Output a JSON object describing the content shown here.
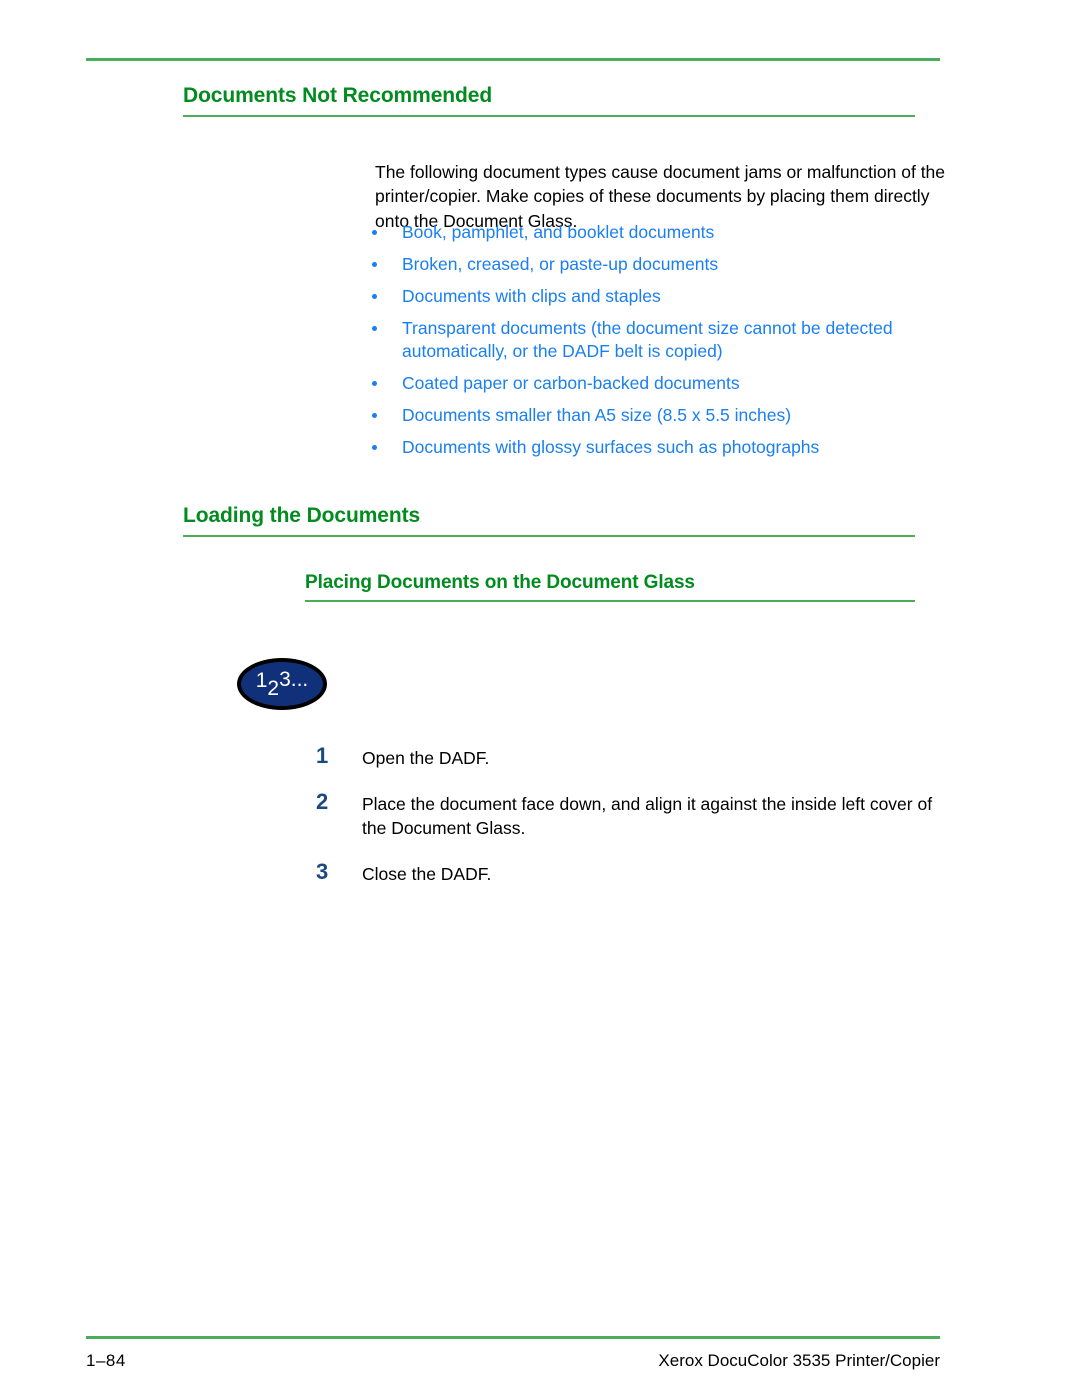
{
  "page": {
    "section_heading": "Documents Not Recommended",
    "intro_paragraph": "The following document types cause document jams or malfunction of the printer/copier. Make copies of these documents by placing them directly onto the Document Glass.",
    "not_recommended_items": [
      "Book, pamphlet, and booklet documents",
      "Broken, creased, or paste-up documents",
      "Documents with clips and staples",
      "Transparent documents (the document size cannot be detected automatically, or the DADF belt is copied)",
      "Coated paper or carbon-backed documents",
      "Documents smaller than A5 size (8.5 x 5.5 inches)",
      "Documents with glossy surfaces such as photographs"
    ],
    "loading_heading": "Loading the Documents",
    "placing_heading": "Placing Documents on the Document Glass",
    "procedure_badge": {
      "digit_one": "1",
      "digit_two": "2",
      "digit_three": "3",
      "ellipsis": "..."
    },
    "steps": [
      {
        "number": "1",
        "text": "Open the DADF."
      },
      {
        "number": "2",
        "text": "Place the document face down, and align it against the inside left cover of the Document Glass."
      },
      {
        "number": "3",
        "text": "Close the DADF."
      }
    ]
  },
  "footer": {
    "page_number": "1–84",
    "product": "Xerox DocuColor 3535 Printer/Copier"
  },
  "colors": {
    "heading_green": "#028b1e",
    "rule_green": "#4aad5a",
    "bullet_blue": "#1a7ff0",
    "step_number_navy": "#1b4a7e",
    "badge_navy": "#11307a"
  }
}
